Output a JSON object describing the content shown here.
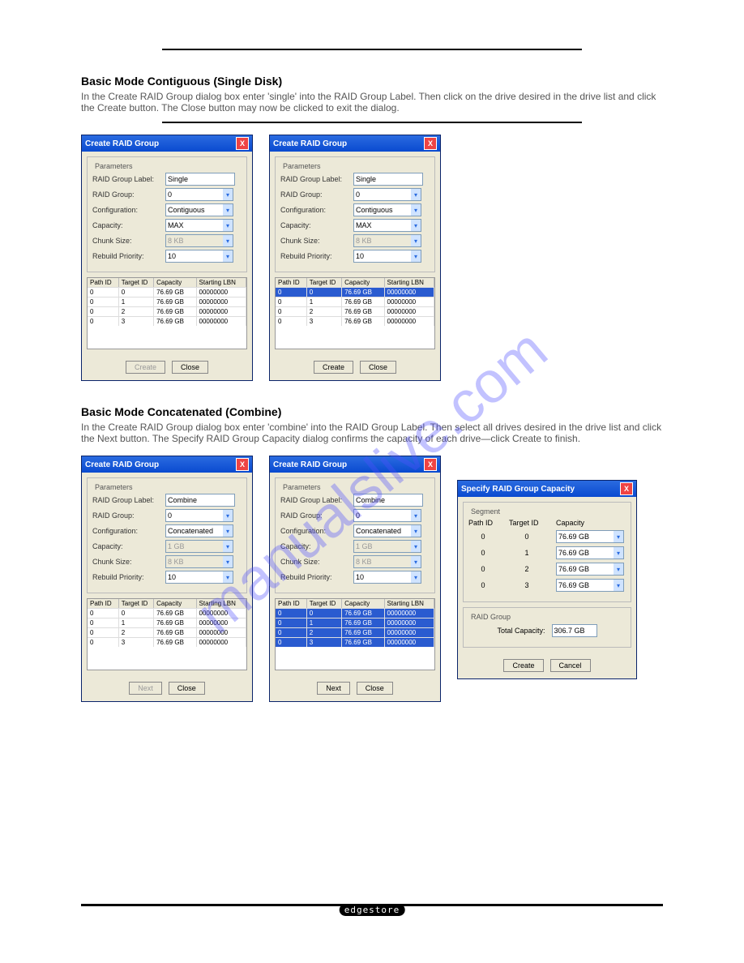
{
  "watermark": "manualslive.com",
  "brand": "edgestore",
  "sections": {
    "single": {
      "title": "Basic Mode Contiguous (Single Disk)",
      "body": "In the Create RAID Group dialog box enter 'single' into the RAID Group Label. Then click on the drive desired in the drive list and click the Create button. The Close button may now be clicked to exit the dialog."
    },
    "combine": {
      "title": "Basic Mode Concatenated (Combine)",
      "body": "In the Create RAID Group dialog box enter 'combine' into the RAID Group Label. Then select all drives desired in the drive list and click the Next button. The Specify RAID Group Capacity dialog confirms the capacity of each drive—click Create to finish."
    }
  },
  "dlg": {
    "title_create": "Create RAID Group",
    "title_capacity": "Specify RAID Group Capacity",
    "params": "Parameters",
    "segment": "Segment",
    "raidgroup_box": "RAID Group",
    "labels": {
      "group_label": "RAID Group Label:",
      "group": "RAID Group:",
      "config": "Configuration:",
      "capacity": "Capacity:",
      "chunk": "Chunk Size:",
      "rebuild": "Rebuild Priority:",
      "total": "Total Capacity:"
    },
    "vals": {
      "single": "Single",
      "combine": "Combine",
      "zero": "0",
      "contig": "Contiguous",
      "concat": "Concatenated",
      "max": "MAX",
      "onegb": "1 GB",
      "chunk_dis": "8 KB",
      "ten": "10",
      "total": "306.7 GB",
      "cap_opt": "76.69 GB"
    },
    "cols": {
      "path": "Path ID",
      "target": "Target ID",
      "cap": "Capacity",
      "lbn": "Starting LBN"
    },
    "drives": [
      {
        "path": "0",
        "target": "0",
        "cap": "76.69 GB",
        "lbn": "00000000"
      },
      {
        "path": "0",
        "target": "1",
        "cap": "76.69 GB",
        "lbn": "00000000"
      },
      {
        "path": "0",
        "target": "2",
        "cap": "76.69 GB",
        "lbn": "00000000"
      },
      {
        "path": "0",
        "target": "3",
        "cap": "76.69 GB",
        "lbn": "00000000"
      }
    ],
    "seg_cols": {
      "path": "Path ID",
      "target": "Target ID",
      "cap": "Capacity"
    },
    "segments": [
      {
        "path": "0",
        "target": "0"
      },
      {
        "path": "0",
        "target": "1"
      },
      {
        "path": "0",
        "target": "2"
      },
      {
        "path": "0",
        "target": "3"
      }
    ],
    "buttons": {
      "create": "Create",
      "close": "Close",
      "next": "Next",
      "cancel": "Cancel"
    }
  }
}
